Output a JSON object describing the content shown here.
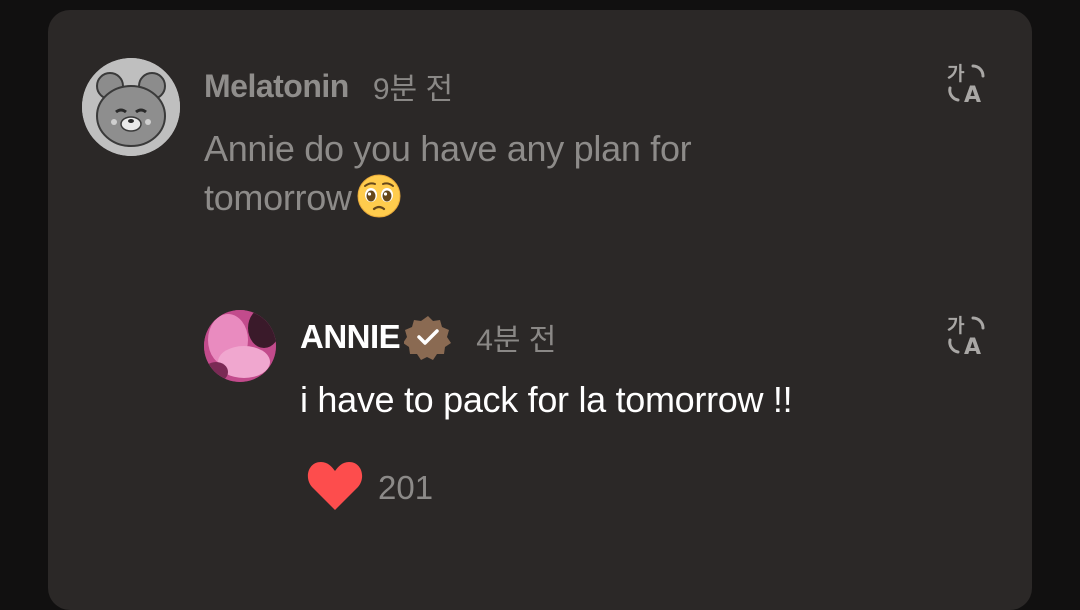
{
  "colors": {
    "background": "#111010",
    "card": "#2b2827",
    "muted_text": "#8d8b89",
    "reply_text": "#ffffff",
    "like_heart": "#fd4d4d",
    "verified_badge": "#8a6a52"
  },
  "comment": {
    "username": "Melatonin",
    "time": "9분 전",
    "text": "Annie do you have any plan for tomorrow",
    "emoji": "pleading-face-emoji",
    "translate_icon": "translate-icon"
  },
  "reply": {
    "username": "ANNIE",
    "verified_icon": "verified-badge-icon",
    "time": "4분 전",
    "text": "i have to pack for la tomorrow !!",
    "translate_icon": "translate-icon",
    "likes": {
      "icon": "heart-icon",
      "count": "201"
    }
  }
}
